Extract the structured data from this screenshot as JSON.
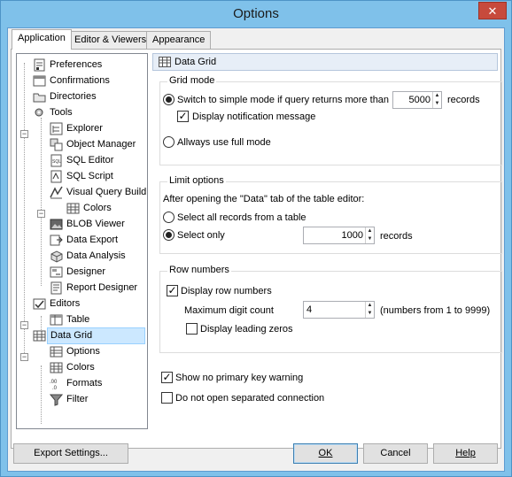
{
  "window": {
    "title": "Options",
    "close_glyph": "✕"
  },
  "tabs": [
    "Application",
    "Editor & Viewers",
    "Appearance"
  ],
  "tree": {
    "items": [
      {
        "label": "Preferences",
        "icon": "preferences-icon"
      },
      {
        "label": "Confirmations",
        "icon": "confirmations-icon"
      },
      {
        "label": "Directories",
        "icon": "folder-icon"
      },
      {
        "label": "Tools",
        "icon": "tools-icon"
      },
      {
        "label": "Explorer",
        "icon": "explorer-icon"
      },
      {
        "label": "Object Manager",
        "icon": "object-manager-icon"
      },
      {
        "label": "SQL Editor",
        "icon": "sql-editor-icon"
      },
      {
        "label": "SQL Script",
        "icon": "sql-script-icon"
      },
      {
        "label": "Visual Query Build",
        "icon": "visual-query-builder-icon"
      },
      {
        "label": "Colors",
        "icon": "colors-grid-icon"
      },
      {
        "label": "BLOB Viewer",
        "icon": "blob-viewer-icon"
      },
      {
        "label": "Data Export",
        "icon": "data-export-icon"
      },
      {
        "label": "Data Analysis",
        "icon": "data-analysis-icon"
      },
      {
        "label": "Designer",
        "icon": "designer-icon"
      },
      {
        "label": "Report Designer",
        "icon": "report-designer-icon"
      },
      {
        "label": "Editors",
        "icon": "editors-icon"
      },
      {
        "label": "Table",
        "icon": "table-icon"
      },
      {
        "label": "Data Grid",
        "icon": "data-grid-icon"
      },
      {
        "label": "Options",
        "icon": "options-grid-icon"
      },
      {
        "label": "Colors",
        "icon": "colors-grid-icon"
      },
      {
        "label": "Formats",
        "icon": "formats-icon"
      },
      {
        "label": "Filter",
        "icon": "filter-icon"
      }
    ],
    "selected": "Data Grid"
  },
  "panel": {
    "title": "Data Grid",
    "grid_mode": {
      "title": "Grid mode",
      "simple_mode_label": "Switch to simple mode if query returns more than",
      "simple_mode_value": "5000",
      "records_label": "records",
      "notification_label": "Display notification message",
      "full_mode_label": "Allways use full mode"
    },
    "limit_options": {
      "title": "Limit options",
      "description": "After opening the \"Data\" tab of the table editor:",
      "select_all_label": "Select all records from a table",
      "select_only_label": "Select only",
      "select_only_value": "1000",
      "records_label": "records"
    },
    "row_numbers": {
      "title": "Row numbers",
      "display_label": "Display row numbers",
      "max_digit_label": "Maximum digit count",
      "max_digit_value": "4",
      "range_label": "(numbers from 1 to 9999)",
      "leading_zeros_label": "Display leading zeros"
    },
    "no_pk_warning_label": "Show no primary key warning",
    "no_separated_label": "Do not open separated connection"
  },
  "buttons": {
    "export": "Export Settings...",
    "ok": "OK",
    "cancel": "Cancel",
    "help": "Help"
  }
}
